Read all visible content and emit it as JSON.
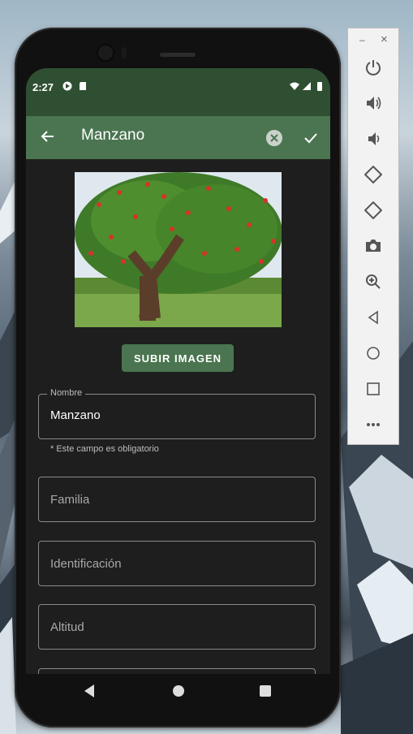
{
  "status_bar": {
    "time": "2:27"
  },
  "app_bar": {
    "title": "Manzano"
  },
  "upload_button": {
    "label": "SUBIR IMAGEN"
  },
  "form": {
    "nombre": {
      "label": "Nombre",
      "value": "Manzano",
      "helper": "* Este campo es obligatorio"
    },
    "familia": {
      "placeholder": "Familia"
    },
    "identificacion": {
      "placeholder": "Identificación"
    },
    "altitud": {
      "placeholder": "Altitud"
    }
  },
  "emulator_panel": {
    "minimize": "–",
    "close": "×",
    "buttons": [
      "power-icon",
      "volume-up-icon",
      "volume-down-icon",
      "rotate-left-icon",
      "rotate-right-icon",
      "camera-icon",
      "zoom-icon",
      "back-icon",
      "home-icon",
      "overview-icon",
      "more-icon"
    ]
  },
  "colors": {
    "status_bar": "#2f4f32",
    "app_bar": "#4a7550",
    "accent": "#4a7550",
    "background": "#1e1e1e"
  }
}
